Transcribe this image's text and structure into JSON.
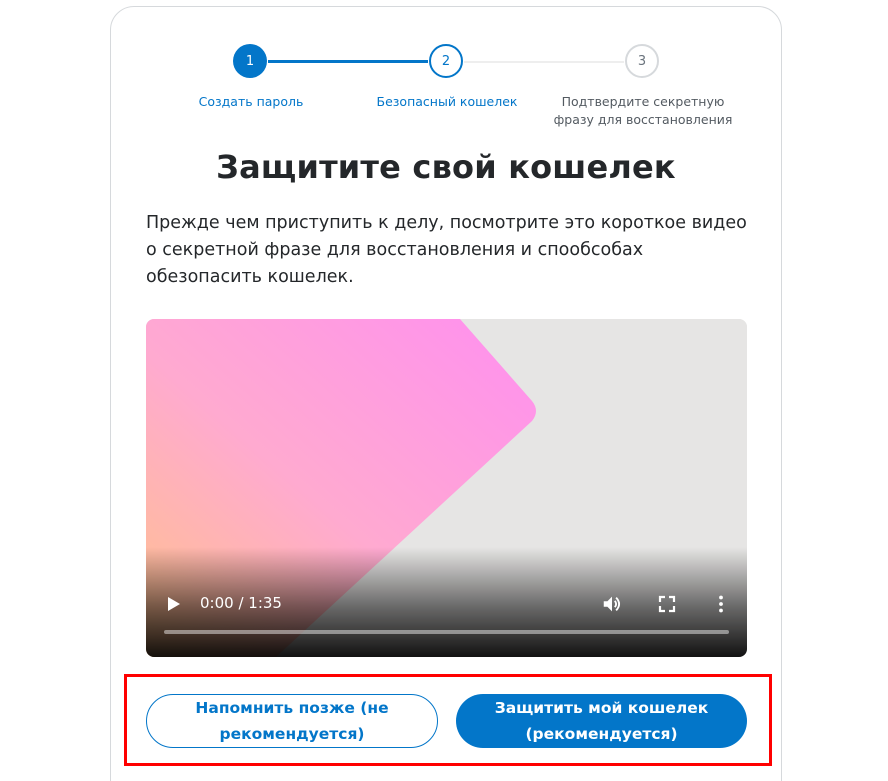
{
  "stepper": {
    "steps": [
      {
        "number": "1",
        "label": "Создать пароль",
        "state": "completed"
      },
      {
        "number": "2",
        "label": "Безопасный кошелек",
        "state": "active"
      },
      {
        "number": "3",
        "label": "Подтвердите секретную фразу для восстановления",
        "state": "upcoming"
      }
    ]
  },
  "main": {
    "title": "Защитите свой кошелек",
    "description": "Прежде чем приступить к делу, посмотрите это короткое видео о секретной фразе для восстановления и спообсобах обезопасить кошелек."
  },
  "video": {
    "time": "0:00 / 1:35",
    "progress": 0,
    "controls": [
      "play-icon",
      "volume-icon",
      "fullscreen-icon",
      "more-options-icon"
    ]
  },
  "actions": {
    "later_label": "Напомнить позже (не рекомендуется)",
    "secure_label": "Защитить мой кошелек (рекомендуется)"
  },
  "colors": {
    "accent": "#0376c9",
    "highlight": "#ff0000",
    "text": "#24272a"
  }
}
